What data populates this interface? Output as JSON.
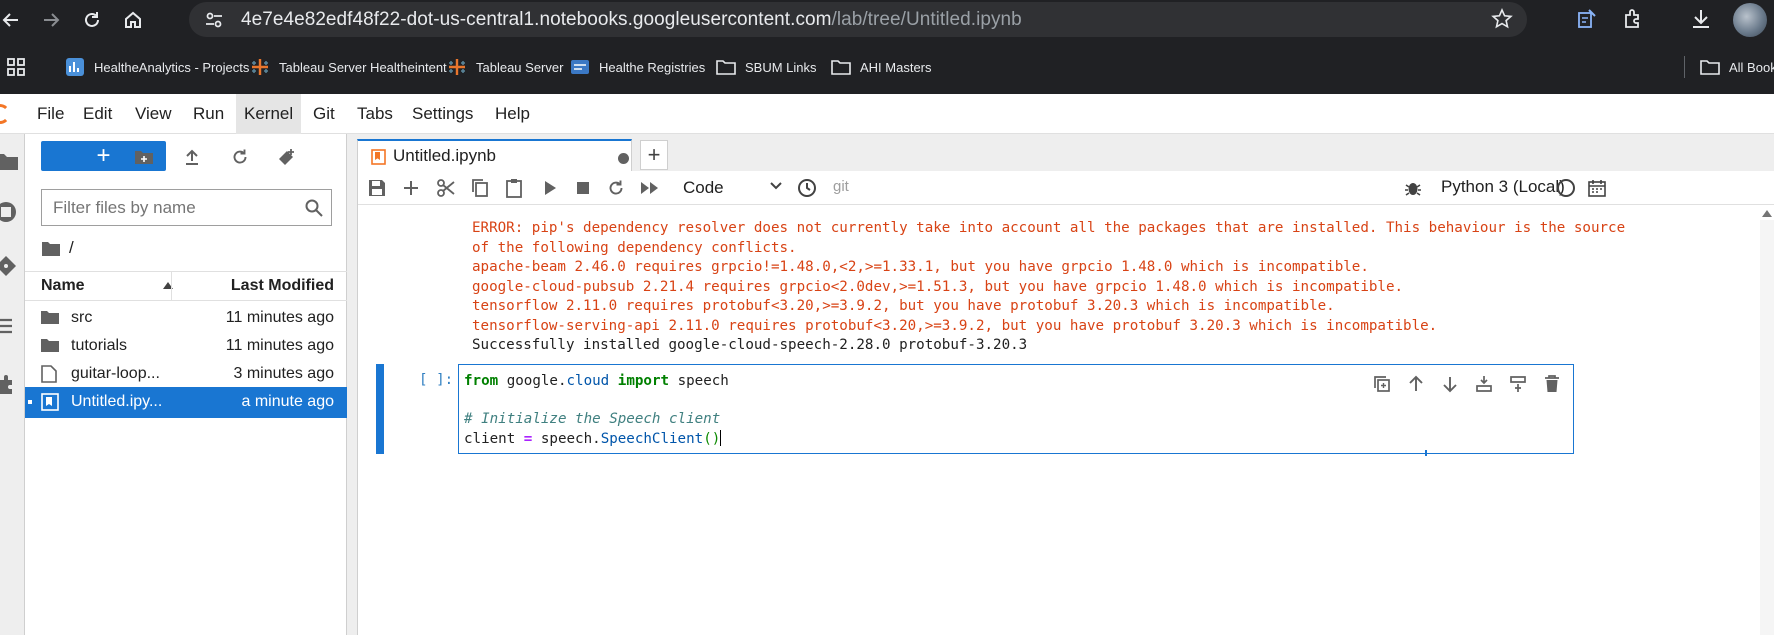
{
  "browser": {
    "url_host": "4e7e4e82edf48f22-dot-us-central1.notebooks.googleusercontent.com",
    "url_path": "/lab/tree/Untitled.ipynb",
    "bookmarks": [
      {
        "label": "HealtheAnalytics - Projects",
        "icon": "analytics-icon"
      },
      {
        "label": "Tableau Server Healtheintent",
        "icon": "tableau-icon"
      },
      {
        "label": "Tableau Server",
        "icon": "tableau-icon"
      },
      {
        "label": "Healthe Registries",
        "icon": "registries-icon"
      },
      {
        "label": "SBUM Links",
        "icon": "folder-icon"
      },
      {
        "label": "AHI Masters",
        "icon": "folder-icon"
      },
      {
        "label": "All Book",
        "icon": "folder-icon"
      }
    ]
  },
  "menubar": {
    "items": [
      "File",
      "Edit",
      "View",
      "Run",
      "Kernel",
      "Git",
      "Tabs",
      "Settings",
      "Help"
    ],
    "active": "Kernel"
  },
  "filebrowser": {
    "new_button": "+",
    "filter_placeholder": "Filter files by name",
    "breadcrumb": "/",
    "col_name": "Name",
    "col_modified": "Last Modified",
    "files": [
      {
        "name": "src",
        "modified": "11 minutes ago",
        "kind": "folder"
      },
      {
        "name": "tutorials",
        "modified": "11 minutes ago",
        "kind": "folder"
      },
      {
        "name": "guitar-loop...",
        "modified": "3 minutes ago",
        "kind": "file"
      },
      {
        "name": "Untitled.ipy...",
        "modified": "a minute ago",
        "kind": "notebook",
        "selected": true
      }
    ]
  },
  "notebook": {
    "tab_title": "Untitled.ipynb",
    "add_tab": "+",
    "cell_type": "Code",
    "git_label": "git",
    "kernel": "Python 3 (Local)",
    "output_lines": [
      {
        "text": "ERROR: pip's dependency resolver does not currently take into account all the packages that are installed. This behaviour is the source",
        "err": true
      },
      {
        "text": "of the following dependency conflicts.",
        "err": true
      },
      {
        "text": "apache-beam 2.46.0 requires grpcio!=1.48.0,<2,>=1.33.1, but you have grpcio 1.48.0 which is incompatible.",
        "err": true
      },
      {
        "text": "google-cloud-pubsub 2.21.4 requires grpcio<2.0dev,>=1.51.3, but you have grpcio 1.48.0 which is incompatible.",
        "err": true
      },
      {
        "text": "tensorflow 2.11.0 requires protobuf<3.20,>=3.9.2, but you have protobuf 3.20.3 which is incompatible.",
        "err": true
      },
      {
        "text": "tensorflow-serving-api 2.11.0 requires protobuf<3.20,>=3.9.2, but you have protobuf 3.20.3 which is incompatible.",
        "err": true
      },
      {
        "text": "Successfully installed google-cloud-speech-2.28.0 protobuf-3.20.3",
        "err": false
      }
    ],
    "cell": {
      "prompt": "[ ]:",
      "line1": {
        "kw_from": "from",
        "module_a": "google",
        "dot": ".",
        "module_b": "cloud",
        "kw_import": "import",
        "name": "speech"
      },
      "line2": "# Initialize the Speech client",
      "line3": {
        "var": "client",
        "op": "=",
        "obj": "speech.",
        "cls": "SpeechClient",
        "parens": "()"
      }
    }
  },
  "colors": {
    "accent": "#1976d2",
    "error_text": "#d84315",
    "keyword": "#008000",
    "jupyter_orange": "#f37626"
  }
}
